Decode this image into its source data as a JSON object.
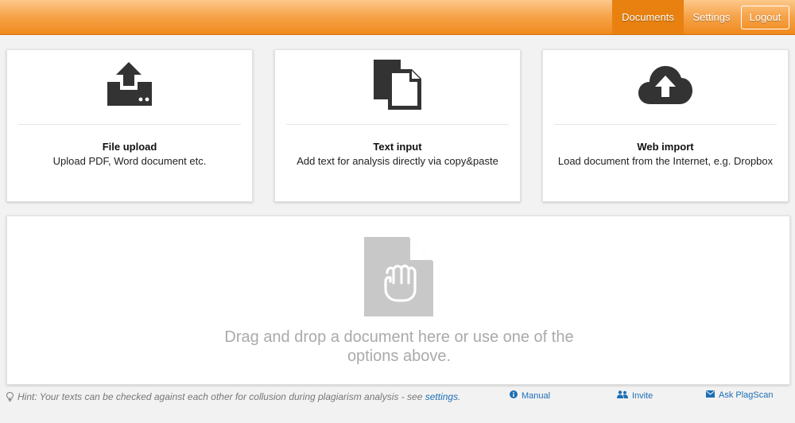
{
  "nav": {
    "documents": "Documents",
    "settings": "Settings",
    "logout": "Logout"
  },
  "cards": [
    {
      "title": "File upload",
      "desc": "Upload PDF, Word document etc.",
      "icon": "upload-icon"
    },
    {
      "title": "Text input",
      "desc": "Add text for analysis directly via copy&paste",
      "icon": "copy-documents-icon"
    },
    {
      "title": "Web import",
      "desc": "Load document from the Internet, e.g. Dropbox",
      "icon": "cloud-upload-icon"
    }
  ],
  "dropzone": {
    "text": "Drag and drop a document here or use one of the options above.",
    "icon": "document-grab-hand-icon"
  },
  "footer": {
    "hint": "Hint: Your texts can be checked against each other for collusion during plagiarism analysis - see ",
    "hint_link": "settings",
    "hint_end": ".",
    "manual": "Manual",
    "invite": "Invite",
    "ask": "Ask PlagScan"
  },
  "colors": {
    "accent_orange": "#f08a1c",
    "link_blue": "#1c6fb5",
    "icon_dark": "#333333"
  }
}
